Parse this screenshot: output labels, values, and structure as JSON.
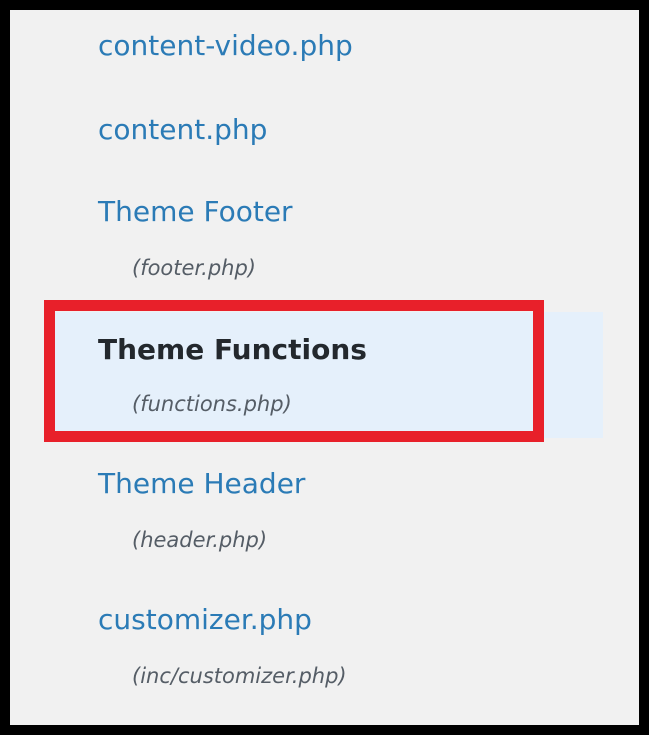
{
  "files": [
    {
      "title": "content-video.php",
      "filename": "",
      "active": false
    },
    {
      "title": "content.php",
      "filename": "",
      "active": false
    },
    {
      "title": "Theme Footer",
      "filename": "(footer.php)",
      "active": false
    },
    {
      "title": "Theme Functions",
      "filename": "(functions.php)",
      "active": true
    },
    {
      "title": "Theme Header",
      "filename": "(header.php)",
      "active": false
    },
    {
      "title": "customizer.php",
      "filename": "(inc/customizer.php)",
      "active": false
    }
  ],
  "highlight": {
    "color": "#e8202a",
    "target": "Theme Functions"
  },
  "colors": {
    "link": "#2b7bb6",
    "active_text": "#23282d",
    "filename": "#555d66",
    "panel_background": "#f1f1f1",
    "active_background": "#e5f0fb",
    "frame": "#000000"
  }
}
